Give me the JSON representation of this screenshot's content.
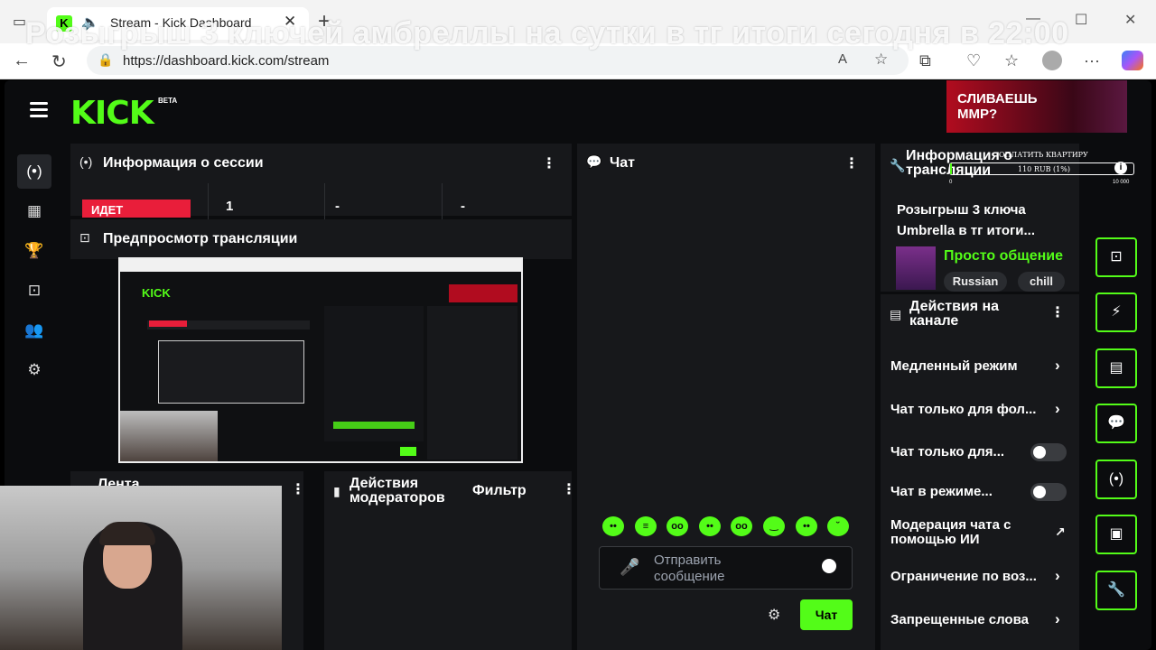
{
  "browser": {
    "tab_title": "Stream - Kick Dashboard",
    "new_tab": "+",
    "url": "https://dashboard.kick.com/stream",
    "overlay_banner": "Розыгрыш 3 ключей амбреллы на сутки в тг итоги сегодня в 22:00"
  },
  "header": {
    "logo": "KICK",
    "beta": "BETA",
    "ad_text": "СЛИВАЕШЬ ММР?"
  },
  "sidebar": {
    "items": [
      {
        "name": "broadcast",
        "icon": "(•)"
      },
      {
        "name": "analytics",
        "icon": "▦"
      },
      {
        "name": "achievements",
        "icon": "🏆"
      },
      {
        "name": "clips",
        "icon": "⊡"
      },
      {
        "name": "community",
        "icon": "👥"
      },
      {
        "name": "settings",
        "icon": "⚙"
      }
    ]
  },
  "session": {
    "title": "Информация о сессии",
    "live_badge": "ИДЕТ",
    "stats": [
      "1",
      "-",
      "-"
    ]
  },
  "preview": {
    "title": "Предпросмотр трансляции"
  },
  "feed": {
    "title": "Лента"
  },
  "mod_actions": {
    "title": "Действия модераторов",
    "filter": "Фильтр"
  },
  "chat": {
    "title": "Чат",
    "placeholder": "Отправить сообщение",
    "send": "Чат"
  },
  "stream_info": {
    "title": "Информация о трансляции",
    "stream_title": "Розыгрыш 3 ключа Umbrella в тг итоги...",
    "category": "Просто общение",
    "tags": [
      "Russian",
      "chill"
    ]
  },
  "donation": {
    "label": "ОПЛАТИТЬ КВАРТИРУ",
    "amount": "110 RUB (1%)",
    "min": "0",
    "max": "10 000",
    "progress_percent": 1
  },
  "channel_actions": {
    "title": "Действия на канале",
    "items": [
      {
        "label": "Медленный режим",
        "control": "arrow"
      },
      {
        "label": "Чат только для фол...",
        "control": "arrow"
      },
      {
        "label": "Чат только для...",
        "control": "toggle"
      },
      {
        "label": "Чат в режиме...",
        "control": "toggle"
      },
      {
        "label": "Модерация чата с помощью ИИ",
        "control": "external"
      },
      {
        "label": "Ограничение по воз...",
        "control": "arrow"
      },
      {
        "label": "Запрещенные слова",
        "control": "arrow"
      }
    ]
  },
  "colors": {
    "accent": "#53fc18",
    "live": "#e91e3a",
    "panel": "#17181b",
    "background": "#0b0c0e"
  }
}
